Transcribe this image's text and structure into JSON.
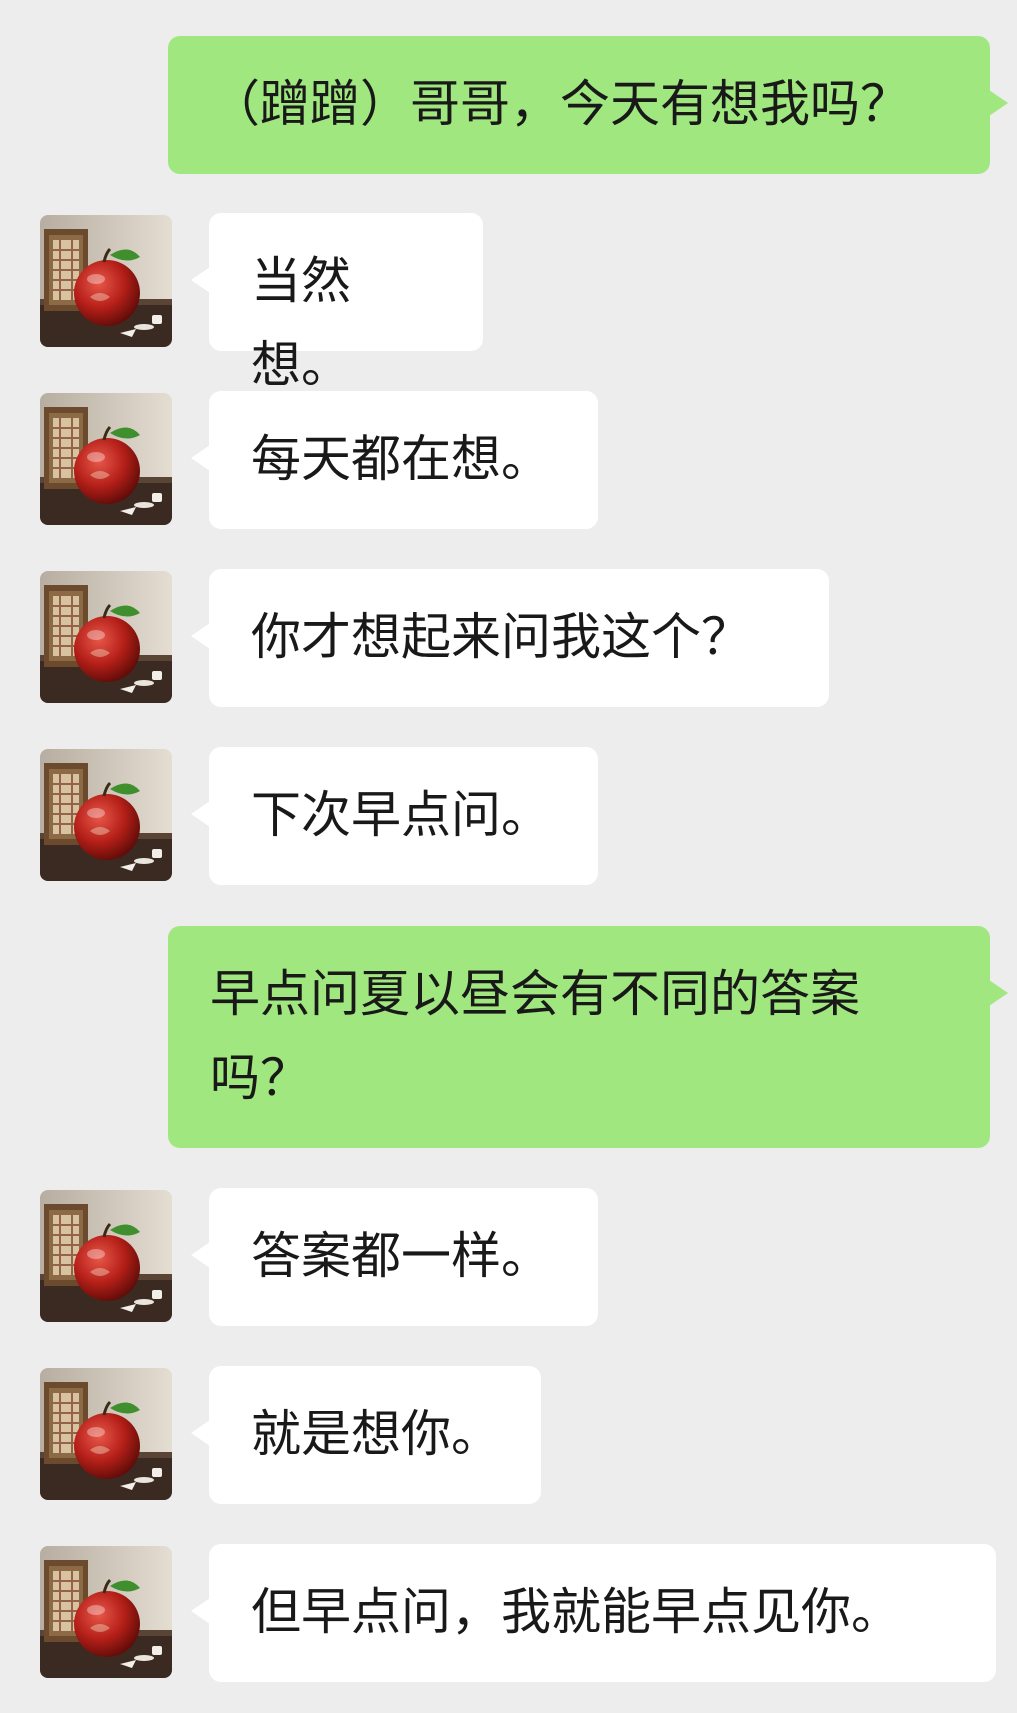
{
  "conversation": {
    "messages": [
      {
        "sender": "self",
        "text": "（蹭蹭）哥哥，今天有想我吗？"
      },
      {
        "sender": "contact",
        "text": "当然想。"
      },
      {
        "sender": "contact",
        "text": "每天都在想。"
      },
      {
        "sender": "contact",
        "text": "你才想起来问我这个？"
      },
      {
        "sender": "contact",
        "text": "下次早点问。"
      },
      {
        "sender": "self",
        "text": "早点问夏以昼会有不同的答案吗？"
      },
      {
        "sender": "contact",
        "text": "答案都一样。"
      },
      {
        "sender": "contact",
        "text": "就是想你。"
      },
      {
        "sender": "contact",
        "text": "但早点问，我就能早点见你。"
      }
    ]
  },
  "contact": {
    "avatar_icon": "red-apple-avatar-icon"
  },
  "theme": {
    "background": "#ededed",
    "self_bubble": "#a0e77f",
    "contact_bubble": "#ffffff",
    "text": "#191919"
  }
}
